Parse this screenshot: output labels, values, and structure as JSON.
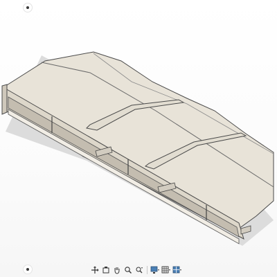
{
  "viewport": {
    "background": "#ffffff",
    "model_face_color": "#e6e0d4",
    "model_edge_color": "#3c3c3c"
  },
  "corner_controls": [
    {
      "icon": "menu-dot-icon"
    },
    {
      "icon": "menu-dot-icon"
    }
  ],
  "navigation_toolbar": {
    "tools": [
      {
        "icon": "orbit-icon"
      },
      {
        "icon": "look-at-icon"
      },
      {
        "icon": "pan-hand-icon"
      },
      {
        "icon": "zoom-icon"
      },
      {
        "icon": "zoom-window-icon"
      },
      {
        "icon": "display-settings-icon"
      },
      {
        "icon": "grid-snaps-icon"
      },
      {
        "icon": "viewports-icon"
      }
    ]
  }
}
